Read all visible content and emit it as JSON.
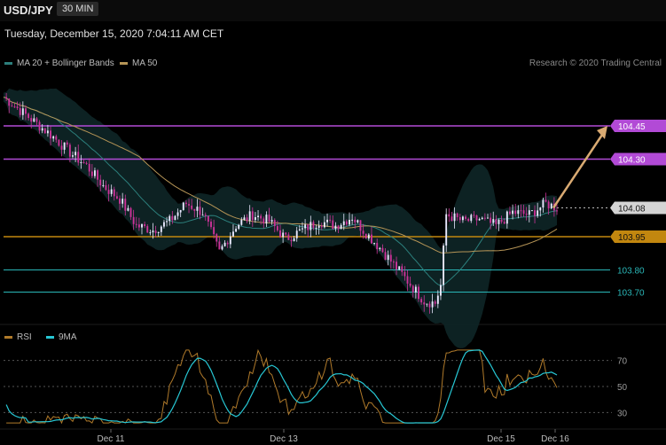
{
  "header": {
    "symbol": "USD/JPY",
    "timeframe": "30 MIN",
    "datetime": "Tuesday, December 15, 2020 7:04:11 AM CET"
  },
  "legend": {
    "ma20": "MA 20 + Bollinger Bands",
    "ma50": "MA 50",
    "credit": "Research © 2020 Trading Central"
  },
  "rsi_legend": {
    "rsi": "RSI",
    "ma9": "9MA"
  },
  "colors": {
    "bg": "#000000",
    "bull": "#e9e9ff",
    "bear": "#cc3399",
    "bollinger": "#0e2627",
    "ma20": "#2c7f7c",
    "ma50": "#b59456",
    "resistance": "#b24ad6",
    "support_gold": "#c2870f",
    "support_teal": "#2ab7b8",
    "arrow": "#d9aa72"
  },
  "chart_data": [
    {
      "type": "candlestick",
      "title": "USD/JPY 30 MIN",
      "ylim": [
        103.57,
        104.69
      ],
      "price_levels": [
        {
          "value": 104.45,
          "label": "104.45",
          "kind": "resistance"
        },
        {
          "value": 104.3,
          "label": "104.30",
          "kind": "resistance"
        },
        {
          "value": 104.08,
          "label": "104.08",
          "kind": "last"
        },
        {
          "value": 103.95,
          "label": "103.95",
          "kind": "support"
        },
        {
          "value": 103.8,
          "label": "103.80",
          "kind": "support"
        },
        {
          "value": 103.7,
          "label": "103.70",
          "kind": "support"
        }
      ],
      "forecast_arrow": {
        "from": 104.08,
        "to": 104.45
      },
      "x_ticks": [
        "Dec 11",
        "Dec 13",
        "Dec 15",
        "Dec 16"
      ],
      "close_path": [
        [
          0,
          104.58
        ],
        [
          6,
          104.52
        ],
        [
          12,
          104.46
        ],
        [
          18,
          104.4
        ],
        [
          24,
          104.33
        ],
        [
          30,
          104.27
        ],
        [
          36,
          104.18
        ],
        [
          42,
          104.12
        ],
        [
          48,
          104.0
        ],
        [
          54,
          103.98
        ],
        [
          60,
          104.02
        ],
        [
          66,
          104.1
        ],
        [
          72,
          104.06
        ],
        [
          78,
          103.88
        ],
        [
          84,
          104.0
        ],
        [
          90,
          104.05
        ],
        [
          96,
          104.02
        ],
        [
          102,
          103.94
        ],
        [
          108,
          103.98
        ],
        [
          114,
          104.02
        ],
        [
          120,
          104.0
        ],
        [
          126,
          104.04
        ],
        [
          130,
          103.98
        ],
        [
          136,
          103.9
        ],
        [
          140,
          103.84
        ],
        [
          144,
          103.78
        ],
        [
          148,
          103.72
        ],
        [
          152,
          103.66
        ],
        [
          156,
          103.65
        ],
        [
          158,
          103.73
        ],
        [
          160,
          104.05
        ],
        [
          166,
          104.02
        ],
        [
          172,
          104.03
        ],
        [
          178,
          104.0
        ],
        [
          184,
          104.06
        ],
        [
          190,
          104.05
        ],
        [
          196,
          104.1
        ],
        [
          200,
          104.08
        ]
      ]
    },
    {
      "type": "line",
      "title": "RSI",
      "ylim": [
        20,
        80
      ],
      "y_ticks": [
        70,
        50,
        30
      ],
      "x_ticks": [
        "Dec 11",
        "Dec 13",
        "Dec 15",
        "Dec 16"
      ]
    }
  ]
}
